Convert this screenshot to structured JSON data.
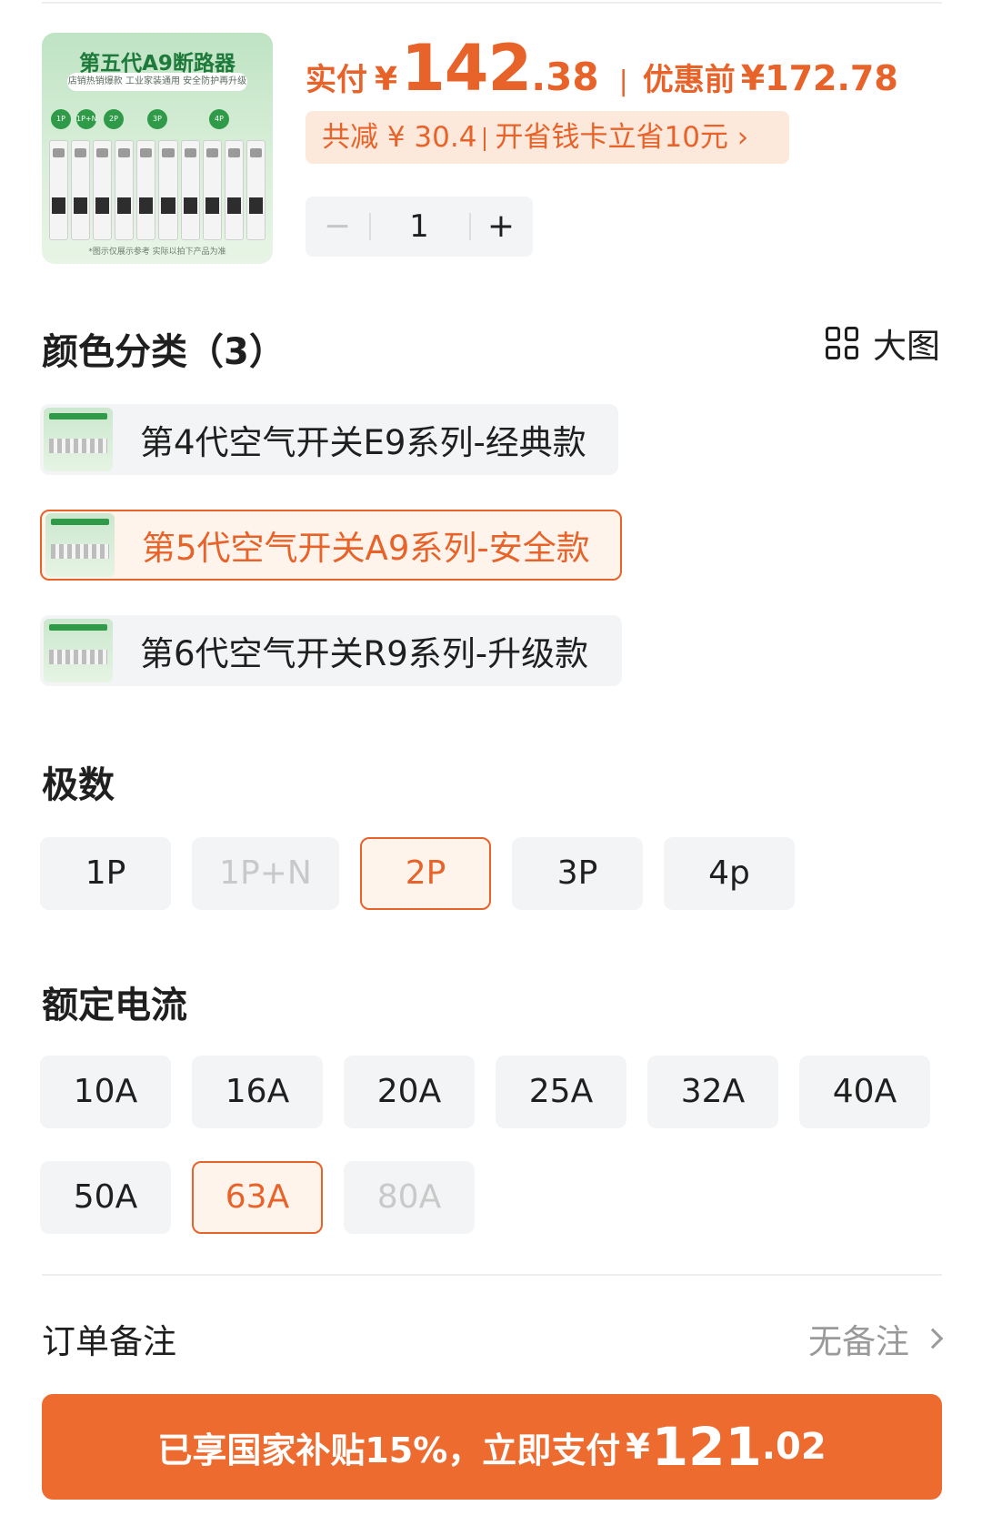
{
  "product": {
    "thumb_title": "第五代A9断路器",
    "thumb_sub": "店销热销爆款 工业家装通用 安全防护再升级",
    "thumb_dots": [
      "1P",
      "1P+N",
      "2P",
      "3P",
      "4P"
    ],
    "thumb_note": "*图示仅展示参考 实际以拍下产品为准"
  },
  "price": {
    "pay_label": "实付",
    "yen": "¥",
    "pay_int": "142",
    "pay_dec": ".38",
    "separator": "|",
    "orig_label": "优惠前",
    "orig_value": "¥172.78"
  },
  "discount": {
    "left": "共减 ¥ 30.4",
    "right": "开省钱卡立省10元 ›"
  },
  "stepper": {
    "minus": "−",
    "value": "1",
    "plus": "+"
  },
  "color_section": {
    "title": "颜色分类（3）",
    "big_view": "大图",
    "options": [
      {
        "label": "第4代空气开关E9系列-经典款",
        "selected": false
      },
      {
        "label": "第5代空气开关A9系列-安全款",
        "selected": true
      },
      {
        "label": "第6代空气开关R9系列-升级款",
        "selected": false
      }
    ]
  },
  "poles_section": {
    "title": "极数",
    "options": [
      "1P",
      "1P+N",
      "2P",
      "3P",
      "4p"
    ],
    "selected": "2P",
    "disabled": [
      "1P+N"
    ]
  },
  "current_section": {
    "title": "额定电流",
    "options": [
      "10A",
      "16A",
      "20A",
      "25A",
      "32A",
      "40A",
      "50A",
      "63A",
      "80A"
    ],
    "selected": "63A",
    "disabled": [
      "80A"
    ]
  },
  "remark": {
    "label": "订单备注",
    "value": "无备注"
  },
  "pay_button": {
    "text": "已享国家补贴15%，立即支付",
    "yen": "¥",
    "int": "121",
    "dec": ".02"
  },
  "colors": {
    "accent": "#e8632a",
    "button": "#ee6b30",
    "chip_bg": "#f3f4f6",
    "selected_bg": "#fff4ec",
    "pill_bg": "#fde9dc"
  }
}
